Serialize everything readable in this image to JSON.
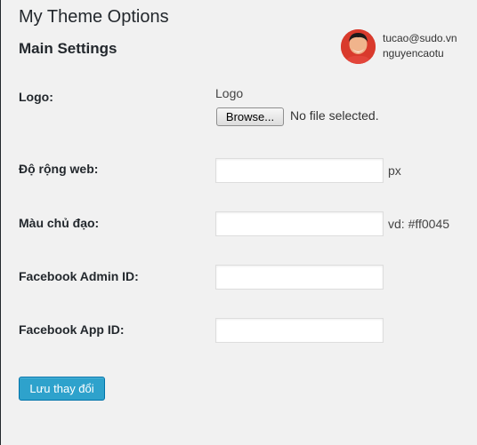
{
  "page": {
    "title": "My Theme Options",
    "section_title": "Main Settings"
  },
  "profile": {
    "email": "tucao@sudo.vn",
    "name": "nguyencaotu"
  },
  "form": {
    "logo": {
      "label": "Logo:",
      "caption": "Logo",
      "browse_label": "Browse...",
      "file_status": "No file selected."
    },
    "web_width": {
      "label": "Độ rộng web:",
      "value": "",
      "suffix": "px"
    },
    "main_color": {
      "label": "Màu chủ đạo:",
      "value": "",
      "suffix": "vd: #ff0045"
    },
    "facebook_admin_id": {
      "label": "Facebook Admin ID:",
      "value": ""
    },
    "facebook_app_id": {
      "label": "Facebook App ID:",
      "value": ""
    },
    "save_label": "Lưu thay đổi"
  },
  "colors": {
    "background": "#f1f1f1",
    "primary_button": "#2ea2cc",
    "primary_button_border": "#0073aa",
    "text": "#23282d"
  },
  "icons": {
    "avatar": "user-avatar-photo"
  }
}
